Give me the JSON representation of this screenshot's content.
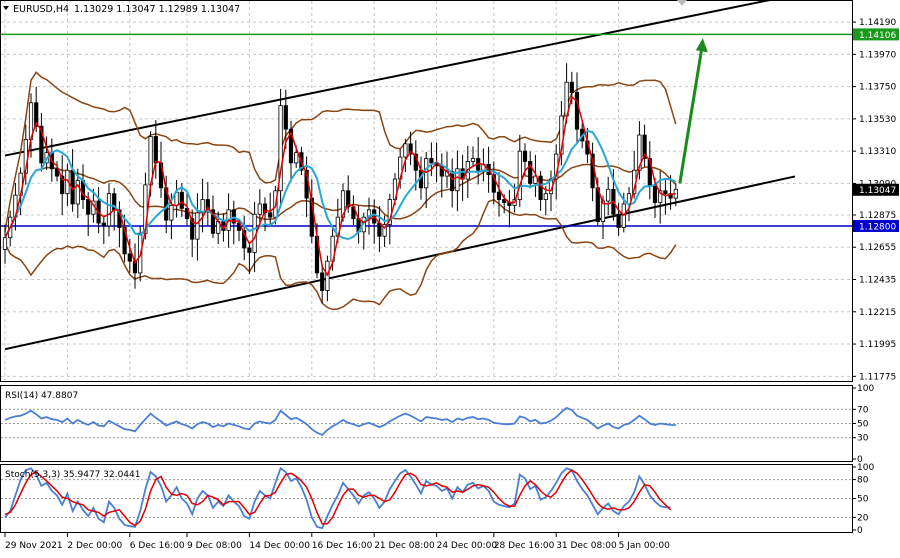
{
  "header": {
    "symbol": "EURUSD,H4",
    "ohlc": "1.13029 1.13047 1.12989 1.13047"
  },
  "colors": {
    "bg": "#ffffff",
    "grid": "#c8c8c8",
    "green_level": "#1a9a1a",
    "blue_level": "#0000cc",
    "channel": "#000000",
    "bollinger": "#8b4513",
    "fast_ma": "#e00000",
    "slow_ma": "#29a8d8",
    "arrow": "#1a8a1a",
    "rsi": "#4a7fd4",
    "stoch_main": "#4a7fd4",
    "stoch_signal": "#e00000"
  },
  "chart_data": [
    {
      "type": "candlestick",
      "symbol": "EURUSD",
      "timeframe": "H4",
      "y_ticks": [
        "1.14190",
        "1.13970",
        "1.13750",
        "1.13530",
        "1.13310",
        "1.13090",
        "1.12875",
        "1.12655",
        "1.12435",
        "1.12215",
        "1.11995",
        "1.11775"
      ],
      "y_range": [
        1.1175,
        1.1432
      ],
      "x_ticks": [
        "29 Nov 2021",
        "2 Dec 00:00",
        "6 Dec 16:00",
        "9 Dec 08:00",
        "14 Dec 00:00",
        "16 Dec 16:00",
        "21 Dec 08:00",
        "24 Dec 00:00",
        "28 Dec 16:00",
        "31 Dec 08:00",
        "5 Jan 00:00"
      ],
      "levels": [
        {
          "price": 1.14106,
          "label": "1.14106",
          "role": "resistance"
        },
        {
          "price": 1.128,
          "label": "1.12800",
          "role": "support"
        }
      ],
      "current_price": {
        "price": 1.13047,
        "label": "1.13047"
      },
      "channel_upper": [
        [
          0,
          1.1328
        ],
        [
          129,
          1.1421
        ]
      ],
      "channel_lower": [
        [
          0,
          1.1196
        ],
        [
          129,
          1.1296
        ]
      ],
      "projection_arrow": {
        "from_price": 1.1309,
        "to_price": 1.1408
      },
      "closes": [
        1.1272,
        1.1286,
        1.1301,
        1.1316,
        1.1339,
        1.1364,
        1.1348,
        1.1323,
        1.133,
        1.1319,
        1.1314,
        1.1302,
        1.1318,
        1.1295,
        1.1311,
        1.1298,
        1.1288,
        1.1297,
        1.1282,
        1.128,
        1.1302,
        1.1291,
        1.1279,
        1.1261,
        1.1256,
        1.1248,
        1.1275,
        1.1308,
        1.1341,
        1.1323,
        1.1306,
        1.1284,
        1.1294,
        1.1303,
        1.1292,
        1.1285,
        1.1271,
        1.1289,
        1.1298,
        1.1291,
        1.1275,
        1.1283,
        1.1277,
        1.1291,
        1.1282,
        1.1277,
        1.1265,
        1.1262,
        1.1288,
        1.1295,
        1.1289,
        1.1286,
        1.1304,
        1.1362,
        1.1346,
        1.1323,
        1.133,
        1.1318,
        1.1299,
        1.1273,
        1.1248,
        1.1236,
        1.1256,
        1.1273,
        1.1286,
        1.1304,
        1.1293,
        1.1285,
        1.1276,
        1.1286,
        1.1291,
        1.1282,
        1.1273,
        1.1281,
        1.1298,
        1.1312,
        1.1327,
        1.1336,
        1.1329,
        1.1318,
        1.1306,
        1.1326,
        1.1323,
        1.1321,
        1.1314,
        1.1317,
        1.1304,
        1.1319,
        1.1312,
        1.1324,
        1.1326,
        1.1318,
        1.1322,
        1.1315,
        1.1303,
        1.1298,
        1.1296,
        1.1294,
        1.1298,
        1.1331,
        1.1324,
        1.1309,
        1.1314,
        1.1298,
        1.1302,
        1.1312,
        1.1329,
        1.1355,
        1.1378,
        1.1371,
        1.1346,
        1.1338,
        1.1329,
        1.1306,
        1.1283,
        1.1297,
        1.1305,
        1.1288,
        1.1279,
        1.1295,
        1.1302,
        1.1318,
        1.1342,
        1.1326,
        1.1307,
        1.1296,
        1.1304,
        1.1302,
        1.1299,
        1.1305
      ]
    },
    {
      "type": "line",
      "title": "RSI(14) 47.8807",
      "y_ticks": [
        "100",
        "70",
        "50",
        "30",
        "0"
      ],
      "y_range": [
        0,
        100
      ],
      "levels": [
        70,
        50,
        30
      ],
      "values": [
        55,
        58,
        60,
        61,
        64,
        68,
        63,
        57,
        59,
        56,
        55,
        52,
        57,
        50,
        55,
        51,
        48,
        52,
        47,
        46,
        54,
        50,
        46,
        42,
        41,
        39,
        48,
        56,
        64,
        58,
        53,
        47,
        50,
        53,
        49,
        47,
        43,
        49,
        52,
        50,
        45,
        48,
        46,
        50,
        48,
        46,
        43,
        42,
        50,
        53,
        51,
        50,
        55,
        68,
        62,
        56,
        58,
        54,
        49,
        42,
        37,
        34,
        41,
        46,
        50,
        55,
        51,
        49,
        46,
        49,
        51,
        48,
        45,
        48,
        53,
        57,
        61,
        64,
        61,
        57,
        53,
        59,
        58,
        57,
        55,
        56,
        52,
        57,
        55,
        58,
        59,
        56,
        57,
        55,
        51,
        50,
        49,
        49,
        50,
        60,
        58,
        53,
        55,
        50,
        51,
        54,
        59,
        66,
        72,
        69,
        61,
        58,
        55,
        49,
        43,
        47,
        50,
        45,
        43,
        48,
        50,
        55,
        61,
        56,
        50,
        48,
        50,
        49,
        48,
        47.88
      ]
    },
    {
      "type": "line",
      "title": "Stoch(5,3,3) 35.9477 32.0441",
      "y_ticks": [
        "100",
        "80",
        "50",
        "20",
        "0"
      ],
      "y_range": [
        0,
        100
      ],
      "levels": [
        80,
        50,
        20
      ],
      "series": [
        {
          "name": "main",
          "values": [
            20,
            30,
            55,
            80,
            95,
            98,
            88,
            70,
            75,
            62,
            55,
            40,
            58,
            30,
            45,
            32,
            22,
            35,
            18,
            12,
            45,
            35,
            18,
            8,
            6,
            5,
            30,
            65,
            92,
            85,
            70,
            45,
            55,
            68,
            50,
            42,
            25,
            50,
            62,
            55,
            35,
            45,
            38,
            55,
            45,
            38,
            22,
            18,
            45,
            62,
            55,
            50,
            75,
            98,
            92,
            78,
            82,
            68,
            48,
            20,
            5,
            3,
            22,
            40,
            55,
            75,
            65,
            55,
            42,
            55,
            60,
            50,
            35,
            45,
            65,
            78,
            90,
            95,
            85,
            72,
            58,
            78,
            72,
            70,
            62,
            66,
            50,
            68,
            60,
            72,
            75,
            66,
            70,
            62,
            45,
            40,
            38,
            36,
            42,
            88,
            82,
            65,
            70,
            48,
            52,
            62,
            75,
            90,
            98,
            95,
            78,
            65,
            55,
            40,
            25,
            35,
            42,
            30,
            25,
            38,
            45,
            60,
            85,
            72,
            55,
            45,
            38,
            36,
            35.95
          ]
        },
        {
          "name": "signal",
          "values": [
            25,
            28,
            40,
            58,
            75,
            88,
            92,
            85,
            78,
            70,
            62,
            52,
            50,
            45,
            42,
            40,
            32,
            30,
            28,
            22,
            28,
            30,
            32,
            22,
            12,
            7,
            14,
            33,
            62,
            80,
            85,
            68,
            57,
            55,
            58,
            55,
            42,
            40,
            45,
            55,
            52,
            48,
            40,
            45,
            45,
            45,
            35,
            25,
            28,
            42,
            54,
            55,
            60,
            75,
            88,
            90,
            85,
            78,
            68,
            50,
            28,
            10,
            10,
            20,
            38,
            55,
            65,
            65,
            55,
            52,
            55,
            55,
            50,
            45,
            48,
            60,
            75,
            88,
            90,
            85,
            72,
            70,
            72,
            75,
            70,
            68,
            60,
            62,
            60,
            65,
            70,
            72,
            70,
            68,
            60,
            50,
            42,
            38,
            38,
            55,
            70,
            78,
            72,
            62,
            55,
            52,
            60,
            75,
            88,
            95,
            90,
            80,
            68,
            55,
            42,
            35,
            33,
            35,
            32,
            32,
            35,
            45,
            60,
            72,
            70,
            60,
            48,
            40,
            32.04
          ]
        }
      ]
    }
  ]
}
